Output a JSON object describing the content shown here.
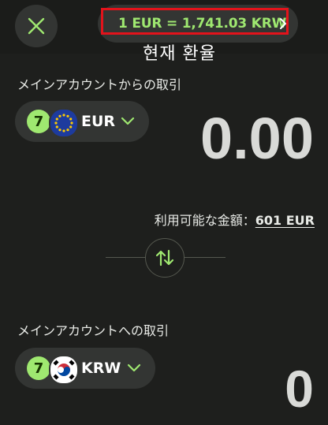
{
  "header": {
    "exchange_rate": "1 EUR = 1,741.03 KRW",
    "annotation": "현재 환율"
  },
  "from": {
    "label": "メインアカウントからの取引",
    "currency": "EUR",
    "amount": "0.00"
  },
  "available": {
    "label": "利用可能な金額：",
    "value": "601 EUR"
  },
  "to": {
    "label": "メインアカウントへの取引",
    "currency": "KRW",
    "amount": "0"
  },
  "wise_logo": "7",
  "colors": {
    "accent_green": "#9fe870",
    "background": "#1e1f1d",
    "pill": "#333533",
    "highlight_red": "#e3131b"
  },
  "icons": [
    "close-icon",
    "chevron-right-icon",
    "chevron-down-icon",
    "swap-arrows-icon",
    "eu-flag-icon",
    "korea-flag-icon",
    "wise-logo"
  ]
}
